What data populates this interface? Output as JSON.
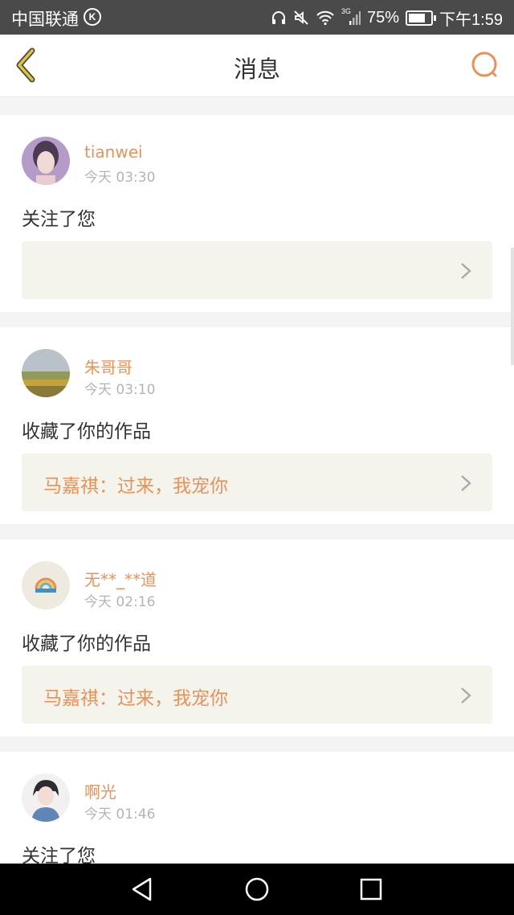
{
  "status_bar": {
    "carrier": "中国联通",
    "carrier_badge": "K",
    "network": "3G",
    "battery": "75%",
    "battery_level": 0.75,
    "time": "下午1:59",
    "icons": [
      "headset-icon",
      "mute-icon",
      "wifi-icon",
      "signal-icon",
      "battery-icon"
    ]
  },
  "nav": {
    "title": "消息",
    "back_icon": "chevron-left-icon",
    "search_icon": "search-icon"
  },
  "messages": [
    {
      "username": "tianwei",
      "time": "今天 03:30",
      "action": "关注了您",
      "ref": ""
    },
    {
      "username": "朱哥哥",
      "time": "今天 03:10",
      "action": "收藏了你的作品",
      "ref": "马嘉祺：过来，我宠你"
    },
    {
      "username": "无**_**道",
      "time": "今天 02:16",
      "action": "收藏了你的作品",
      "ref": "马嘉祺：过来，我宠你"
    },
    {
      "username": "啊光",
      "time": "今天 01:46",
      "action": "关注了您",
      "ref": ""
    }
  ],
  "colors": {
    "accent": "#e8925a",
    "back_icon": "#c9a227",
    "status_bar": "#4a4a4a",
    "ref_background": "#f4f3ec"
  },
  "system_nav": [
    "back-triangle-icon",
    "home-circle-icon",
    "recents-square-icon"
  ]
}
